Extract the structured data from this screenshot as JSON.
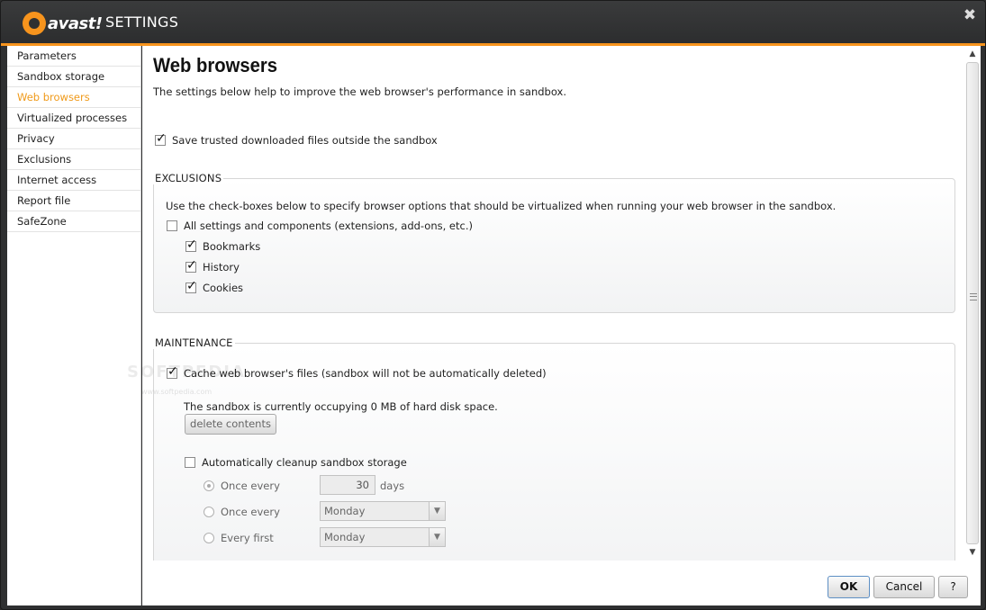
{
  "titlebar": {
    "brand": "avast!",
    "title": "SETTINGS",
    "close_glyph": "✖"
  },
  "sidebar": {
    "items": [
      {
        "label": "Parameters"
      },
      {
        "label": "Sandbox storage"
      },
      {
        "label": "Web browsers",
        "active": true
      },
      {
        "label": "Virtualized processes"
      },
      {
        "label": "Privacy"
      },
      {
        "label": "Exclusions"
      },
      {
        "label": "Internet access"
      },
      {
        "label": "Report file"
      },
      {
        "label": "SafeZone"
      }
    ]
  },
  "main": {
    "title": "Web browsers",
    "description": "The settings below help to improve the web browser's performance in sandbox.",
    "save_trusted": {
      "label": "Save trusted downloaded files outside the sandbox",
      "checked": true
    },
    "exclusions": {
      "title": "EXCLUSIONS",
      "description": "Use the check-boxes below to specify browser options that should be virtualized when running your web browser in the sandbox.",
      "all_settings": {
        "label": "All settings and components (extensions, add-ons, etc.)",
        "checked": false
      },
      "bookmarks": {
        "label": "Bookmarks",
        "checked": true
      },
      "history": {
        "label": "History",
        "checked": true
      },
      "cookies": {
        "label": "Cookies",
        "checked": true
      }
    },
    "maintenance": {
      "title": "MAINTENANCE",
      "cache": {
        "label": "Cache web browser's files (sandbox will not be automatically deleted)",
        "checked": true
      },
      "occupying_text": "The sandbox is currently occupying 0 MB of hard disk space.",
      "delete_button": "delete contents",
      "auto_cleanup": {
        "label": "Automatically cleanup sandbox storage",
        "checked": false
      },
      "option1": {
        "label": "Once every",
        "value": "30",
        "unit": "days",
        "selected": true
      },
      "option2": {
        "label": "Once every",
        "value": "Monday",
        "selected": false
      },
      "option3": {
        "label": "Every first",
        "value": "Monday",
        "selected": false
      }
    }
  },
  "footer": {
    "ok": "OK",
    "cancel": "Cancel",
    "help": "?"
  },
  "watermark": {
    "text": "SOFTPEDIA",
    "small": "www.softpedia.com"
  },
  "colors": {
    "accent": "#f7941d",
    "active_nav": "#f09a1a",
    "titlebar": "#2f3031"
  }
}
